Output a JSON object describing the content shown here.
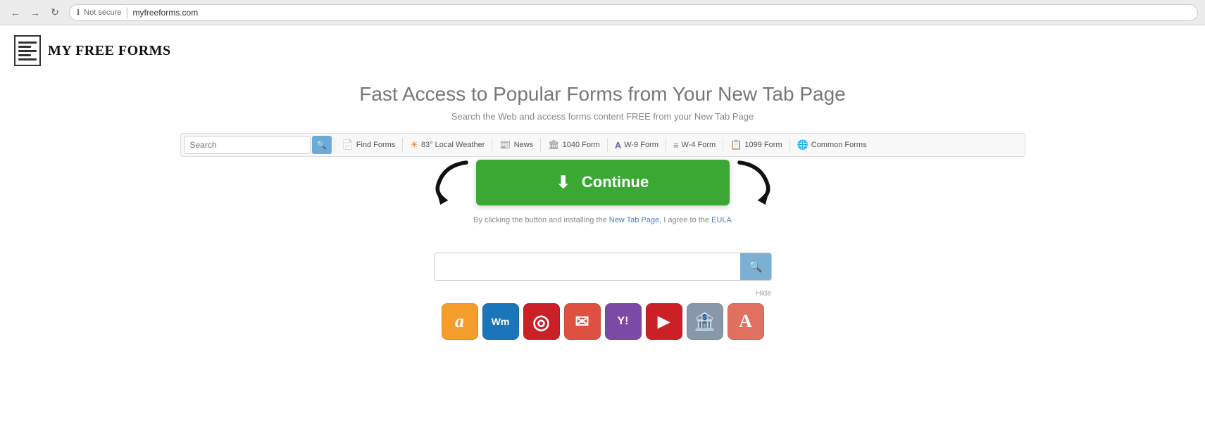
{
  "browser": {
    "back_label": "←",
    "forward_label": "→",
    "refresh_label": "↻",
    "security_label": "Not secure",
    "url": "myfreeforms.com"
  },
  "header": {
    "site_title": "My Free Forms"
  },
  "hero": {
    "title": "Fast Access to Popular Forms from Your New Tab Page",
    "subtitle": "Search the Web and access forms content FREE from your New Tab Page"
  },
  "toolbar": {
    "search_placeholder": "Search",
    "items": [
      {
        "id": "find-forms",
        "label": "Find Forms",
        "icon": "📄",
        "icon_class": "blue"
      },
      {
        "id": "weather",
        "label": "83° Local Weather",
        "icon": "☀",
        "icon_class": "orange"
      },
      {
        "id": "news",
        "label": "News",
        "icon": "📰",
        "icon_class": "gray"
      },
      {
        "id": "1040-form",
        "label": "1040 Form",
        "icon": "🏛",
        "icon_class": "gray"
      },
      {
        "id": "w9-form",
        "label": "W-9 Form",
        "icon": "A",
        "icon_class": "purple"
      },
      {
        "id": "w4-form",
        "label": "W-4 Form",
        "icon": "≡",
        "icon_class": "green"
      },
      {
        "id": "1099-form",
        "label": "1099 Form",
        "icon": "📋",
        "icon_class": "red"
      },
      {
        "id": "common-forms",
        "label": "Common Forms",
        "icon": "🌐",
        "icon_class": "gray"
      }
    ]
  },
  "continue_button": {
    "label": "Continue",
    "download_icon": "⬇"
  },
  "eula": {
    "text_before": "By clicking the button and installing the ",
    "link_text": "New Tab Page",
    "text_middle": ", I agree to the ",
    "eula_link": "EULA"
  },
  "bottom_search": {
    "placeholder": ""
  },
  "app_icons": [
    {
      "id": "amazon",
      "letter": "a",
      "color": "#f59d2a",
      "border_color": "#e68a00",
      "label": "Amazon"
    },
    {
      "id": "walmart",
      "letter": "W",
      "color": "#1a75bb",
      "border_color": "#155e96",
      "label": "Walmart"
    },
    {
      "id": "target",
      "letter": "◎",
      "color": "#cc2027",
      "border_color": "#aa1a1f",
      "label": "Target"
    },
    {
      "id": "gmail",
      "letter": "✉",
      "color": "#e05040",
      "border_color": "#c4372a",
      "label": "Gmail"
    },
    {
      "id": "yahoo",
      "letter": "Y!",
      "color": "#7b49a6",
      "border_color": "#623b85",
      "label": "Yahoo"
    },
    {
      "id": "youtube",
      "letter": "▶",
      "color": "#cc2027",
      "border_color": "#aa1a1f",
      "label": "YouTube"
    },
    {
      "id": "bank",
      "letter": "🏦",
      "color": "#8898aa",
      "border_color": "#6b7d8e",
      "label": "Bank"
    },
    {
      "id": "fonts",
      "letter": "A",
      "color": "#e07060",
      "border_color": "#c45848",
      "label": "Fonts"
    }
  ],
  "hide_button": "Hide"
}
